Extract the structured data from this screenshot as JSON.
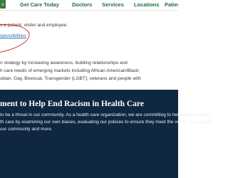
{
  "nav": {
    "logo_text": "e",
    "items": [
      {
        "label": "Get Care Today"
      },
      {
        "label": "Doctors"
      },
      {
        "label": "Services"
      },
      {
        "label": "Locations"
      },
      {
        "label": "Patients"
      }
    ]
  },
  "content": {
    "line1": "s a patient, visitor and employee.",
    "link_fragment": "sponsibilities",
    "paragraph_lines": [
      "n strategy by increasing awareness, building relationships and",
      "h care needs of emerging markets including African American/Black;",
      "sbian, Gay, Bisexual, Transgender (LGBT); veterans and people with"
    ]
  },
  "band": {
    "title": "ment to Help End Racism in Health Care",
    "lines": [
      "to be a threat in our community. As a health care organization, we are committing to helping end racism",
      "th care by examining our own biases, evaluating our policies to ensure they meet the needs of everyone",
      "our community and more."
    ]
  },
  "colors": {
    "nav_link": "#1f6f3a",
    "link": "#2e6db4",
    "annotation": "#e32626",
    "band_bg": "#0f2740"
  }
}
